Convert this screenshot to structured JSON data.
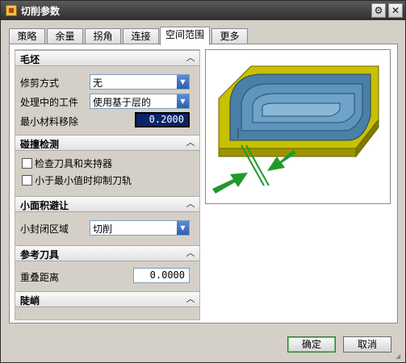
{
  "window": {
    "title": "切削参数"
  },
  "tabs": [
    "策略",
    "余量",
    "拐角",
    "连接",
    "空间范围",
    "更多"
  ],
  "active_tab": "空间范围",
  "sections": {
    "blank": {
      "title": "毛坯",
      "trim_method_label": "修剪方式",
      "trim_method_value": "无",
      "in_process_label": "处理中的工件",
      "in_process_value": "使用基于层的",
      "min_removal_label": "最小材料移除",
      "min_removal_value": "0.2000"
    },
    "collision": {
      "title": "碰撞检测",
      "check_holder_label": "检查刀具和夹持器",
      "suppress_label": "小于最小值时抑制刀轨"
    },
    "small_area": {
      "title": "小面积避让",
      "closed_region_label": "小封闭区域",
      "closed_region_value": "切削"
    },
    "ref_tool": {
      "title": "参考刀具",
      "overlap_label": "重叠距离",
      "overlap_value": "0.0000"
    },
    "steep": {
      "title": "陡峭"
    }
  },
  "buttons": {
    "ok": "确定",
    "cancel": "取消"
  },
  "colors": {
    "accent_blue": "#2c5fb0",
    "part_yellow": "#c8c000",
    "part_blue": "#4a7fa8",
    "arrow_green": "#1f9a2a"
  }
}
